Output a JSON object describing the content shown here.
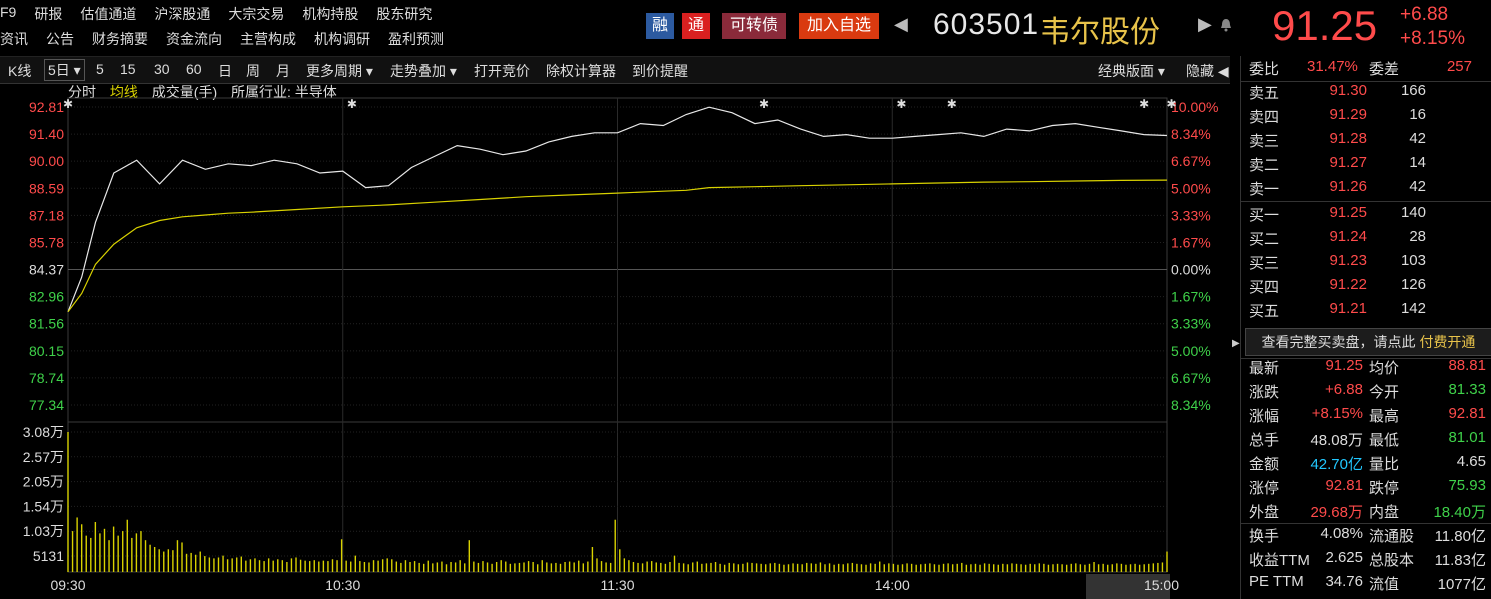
{
  "topnav": {
    "row1": [
      "F9",
      "研报",
      "估值通道",
      "沪深股通",
      "大宗交易",
      "机构持股",
      "股东研究"
    ],
    "row2": [
      "资讯",
      "公告",
      "财务摘要",
      "资金流向",
      "主营构成",
      "机构调研",
      "盈利预测"
    ]
  },
  "stock": {
    "tags": [
      "融",
      "通",
      "可转债",
      "加入自选"
    ],
    "tag_colors": [
      "#2c5aa0",
      "#d92020",
      "#8a2a3a",
      "#d93a10"
    ],
    "code": "603501",
    "name": "韦尔股份",
    "price": "91.25",
    "change": "+6.88",
    "change_pct": "+8.15%",
    "nav_left": "◀",
    "nav_right": "▶",
    "bell": "bell-icon"
  },
  "toolbar": {
    "items": [
      "K线",
      "5日 ▾",
      "5",
      "15",
      "30",
      "60",
      "日",
      "周",
      "月",
      "更多周期 ▾",
      "走势叠加 ▾",
      "打开竞价",
      "除权计算器",
      "到价提醒"
    ],
    "right": [
      "经典版面 ▾",
      "隐藏 ◀"
    ]
  },
  "subheader": {
    "items": [
      "分时",
      "均线",
      "成交量(手)",
      "所属行业: 半导体"
    ]
  },
  "chart_data": {
    "type": "line",
    "title": "",
    "prev_close": 84.37,
    "price_ticks": [
      "92.81",
      "91.40",
      "90.00",
      "88.59",
      "87.18",
      "85.78",
      "84.37",
      "82.96",
      "81.56",
      "80.15",
      "78.74",
      "77.34"
    ],
    "pct_ticks": [
      "10.00%",
      "8.34%",
      "6.67%",
      "5.00%",
      "3.33%",
      "1.67%",
      "0.00%",
      "1.67%",
      "3.33%",
      "5.00%",
      "6.67%",
      "8.34%"
    ],
    "ylim": [
      76.5,
      92.81
    ],
    "x_labels": [
      "09:30",
      "10:30",
      "11:30",
      "14:00",
      "15:00"
    ],
    "volume_ticks": [
      "3.08万",
      "2.57万",
      "2.05万",
      "1.54万",
      "1.03万",
      "5131"
    ],
    "volume_max": 30800,
    "series": [
      {
        "name": "分时",
        "color": "#e8e8e8",
        "x": [
          0,
          3,
          6,
          10,
          15,
          20,
          25,
          30,
          35,
          40,
          45,
          50,
          55,
          60,
          65,
          70,
          75,
          80,
          85,
          90,
          95,
          100,
          105,
          110,
          115,
          120,
          125,
          130,
          135,
          140,
          145,
          150,
          155,
          160,
          165,
          170,
          175,
          180,
          185,
          190,
          195,
          200,
          205,
          210,
          215,
          220,
          225,
          230,
          235,
          240
        ],
        "values": [
          81.6,
          83.5,
          86.5,
          89.2,
          89.9,
          88.6,
          89.9,
          89.4,
          89.7,
          89.6,
          89.9,
          89.7,
          89.2,
          89.3,
          88.4,
          88.5,
          89.5,
          90.1,
          90.7,
          90.5,
          90.2,
          90.4,
          90.9,
          91.2,
          91.4,
          91.4,
          91.9,
          91.8,
          92.4,
          92.8,
          92.5,
          91.9,
          92.1,
          91.6,
          91.2,
          91.3,
          91.1,
          91.1,
          91.2,
          91.3,
          91.4,
          91.2,
          91.6,
          91.5,
          91.8,
          91.9,
          91.7,
          91.5,
          91.3,
          91.25
        ]
      },
      {
        "name": "均线",
        "color": "#d9d200",
        "x": [
          0,
          3,
          6,
          10,
          15,
          20,
          25,
          30,
          35,
          40,
          50,
          60,
          70,
          80,
          90,
          100,
          110,
          120,
          130,
          135,
          140,
          150,
          160,
          170,
          180,
          190,
          200,
          210,
          220,
          230,
          240
        ],
        "values": [
          81.6,
          82.6,
          84.2,
          85.3,
          86.2,
          86.6,
          86.8,
          86.9,
          87.0,
          87.05,
          87.2,
          87.35,
          87.45,
          87.6,
          87.75,
          87.9,
          88.0,
          88.1,
          88.2,
          88.25,
          88.4,
          88.45,
          88.5,
          88.55,
          88.6,
          88.65,
          88.7,
          88.72,
          88.76,
          88.79,
          88.81
        ]
      }
    ],
    "volume": [
      30800,
      9000,
      12000,
      10500,
      8000,
      7500,
      11000,
      8500,
      9500,
      7000,
      10000,
      8000,
      9000,
      11500,
      7500,
      8500,
      9000,
      7000,
      6000,
      5500,
      5000,
      4500,
      5000,
      4800,
      7000,
      6500,
      4000,
      4200,
      3800,
      4500,
      3500,
      3200,
      3000,
      3200,
      3600,
      2800,
      3000,
      3200,
      3400,
      2500,
      2800,
      3000,
      2600,
      2400,
      3000,
      2500,
      2800,
      2600,
      2200,
      3000,
      3200,
      2700,
      2500,
      2400,
      2600,
      2300,
      2500,
      2400,
      2800,
      2600,
      7200,
      2500,
      2300,
      3600,
      2400,
      2200,
      2100,
      2600,
      2500,
      2800,
      3000,
      2800,
      2300,
      2000,
      2600,
      2200,
      2400,
      2000,
      1800,
      2500,
      1900,
      2100,
      2300,
      1700,
      2200,
      2100,
      2600,
      1900,
      7000,
      2300,
      2000,
      2400,
      2100,
      1800,
      2200,
      2600,
      2300,
      1800,
      1900,
      2000,
      2100,
      2400,
      2200,
      1700,
      2600,
      2100,
      1900,
      2000,
      1800,
      2200,
      2300,
      2100,
      2500,
      1900,
      2300,
      5500,
      3000,
      2400,
      2100,
      2000,
      11500,
      5000,
      3000,
      2600,
      2200,
      2000,
      1900,
      2300,
      2400,
      2100,
      2000,
      1800,
      2200,
      3600,
      2000,
      1900,
      1700,
      2100,
      2300,
      1800,
      1900,
      2000,
      2200,
      1800,
      1600,
      2000,
      1900,
      1700,
      1800,
      2100,
      2000,
      1900,
      1800,
      1700,
      1900,
      2000,
      1800,
      1600,
      1700,
      1900,
      1800,
      1700,
      2000,
      1900,
      1800,
      2100,
      1700,
      1900,
      1600,
      1800,
      1700,
      1900,
      2000,
      1800,
      1700,
      1600,
      1900,
      1800,
      2300,
      1700,
      1900,
      1800,
      1600,
      1700,
      1900,
      1800,
      1600,
      1700,
      1800,
      1900,
      1700,
      1600,
      1800,
      1900,
      1700,
      1800,
      2000,
      1600,
      1700,
      1800,
      1600,
      1900,
      1800,
      1700,
      1600,
      1800,
      1700,
      1900,
      1800,
      1700,
      1600,
      1800,
      1700,
      1900,
      1800,
      1600,
      1700,
      1800,
      1700,
      1600,
      1800,
      1900,
      1700,
      1600,
      1800,
      2200,
      1700,
      1800,
      1600,
      1700,
      1900,
      1800,
      1600,
      1700,
      1800,
      1600,
      1700,
      1800,
      1900,
      2000,
      2100,
      4500
    ],
    "stars": [
      0,
      62,
      152,
      182,
      193,
      235,
      241,
      260
    ]
  },
  "side": {
    "weibi_label": "委比",
    "weibi": "31.47%",
    "weicha_label": "委差",
    "weicha": "257",
    "sells": [
      {
        "label": "卖五",
        "price": "91.30",
        "vol": "166"
      },
      {
        "label": "卖四",
        "price": "91.29",
        "vol": "16"
      },
      {
        "label": "卖三",
        "price": "91.28",
        "vol": "42"
      },
      {
        "label": "卖二",
        "price": "91.27",
        "vol": "14"
      },
      {
        "label": "卖一",
        "price": "91.26",
        "vol": "42"
      }
    ],
    "buys": [
      {
        "label": "买一",
        "price": "91.25",
        "vol": "140"
      },
      {
        "label": "买二",
        "price": "91.24",
        "vol": "28"
      },
      {
        "label": "买三",
        "price": "91.23",
        "vol": "103"
      },
      {
        "label": "买四",
        "price": "91.22",
        "vol": "126"
      },
      {
        "label": "买五",
        "price": "91.21",
        "vol": "142"
      }
    ],
    "promo": "查看完整买卖盘，请点此",
    "promo_link": "付费开通",
    "stats": [
      {
        "l1": "最新",
        "v1": "91.25",
        "c1": "red",
        "l2": "均价",
        "v2": "88.81",
        "c2": "red"
      },
      {
        "l1": "涨跌",
        "v1": "+6.88",
        "c1": "red",
        "l2": "今开",
        "v2": "81.33",
        "c2": "green"
      },
      {
        "l1": "涨幅",
        "v1": "+8.15%",
        "c1": "red",
        "l2": "最高",
        "v2": "92.81",
        "c2": "red"
      },
      {
        "l1": "总手",
        "v1": "48.08万",
        "c1": "white",
        "l2": "最低",
        "v2": "81.01",
        "c2": "green"
      },
      {
        "l1": "金额",
        "v1": "42.70亿",
        "c1": "cyan",
        "l2": "量比",
        "v2": "4.65",
        "c2": "white"
      },
      {
        "l1": "涨停",
        "v1": "92.81",
        "c1": "red",
        "l2": "跌停",
        "v2": "75.93",
        "c2": "green"
      },
      {
        "l1": "外盘",
        "v1": "29.68万",
        "c1": "red",
        "l2": "内盘",
        "v2": "18.40万",
        "c2": "green"
      },
      {
        "l1": "换手",
        "v1": "4.08%",
        "c1": "white",
        "l2": "流通股",
        "v2": "11.80亿",
        "c2": "white"
      },
      {
        "l1": "收益TTM",
        "v1": "2.625",
        "c1": "white",
        "l2": "总股本",
        "v2": "11.83亿",
        "c2": "white"
      },
      {
        "l1": "PE TTM",
        "v1": "34.76",
        "c1": "white",
        "l2": "流值",
        "v2": "1077亿",
        "c2": "white"
      }
    ]
  }
}
